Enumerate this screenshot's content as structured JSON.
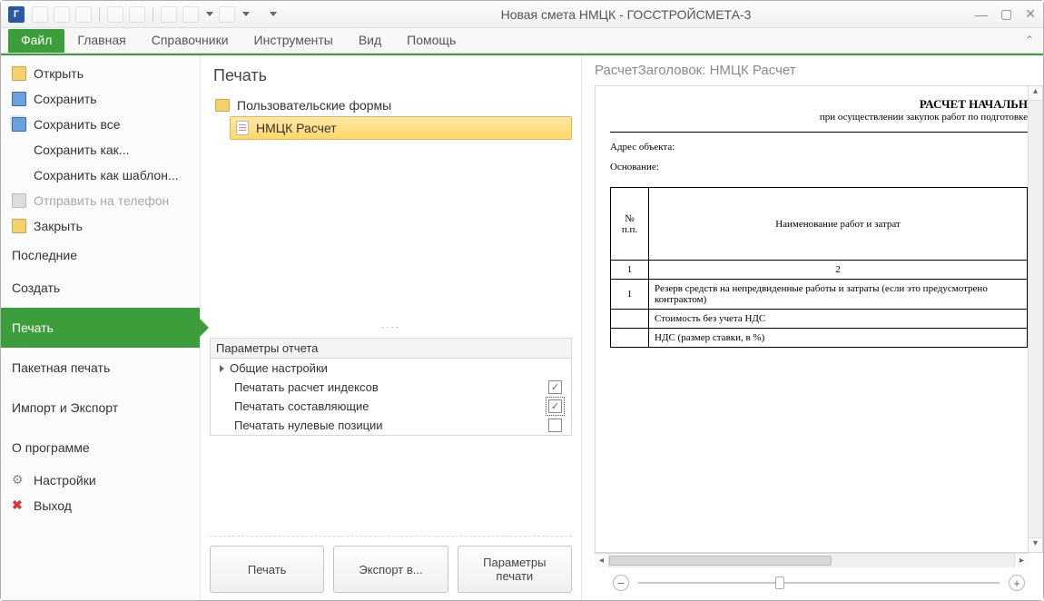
{
  "titlebar": {
    "title": "Новая смета НМЦК - ГОССТРОЙСМЕТА-3"
  },
  "ribbon": {
    "tabs": [
      "Файл",
      "Главная",
      "Справочники",
      "Инструменты",
      "Вид",
      "Помощь"
    ]
  },
  "file_menu": {
    "open": "Открыть",
    "save": "Сохранить",
    "save_all": "Сохранить все",
    "save_as": "Сохранить как...",
    "save_as_template": "Сохранить как шаблон...",
    "send_phone": "Отправить на телефон",
    "close": "Закрыть",
    "recent": "Последние",
    "create": "Создать",
    "print": "Печать",
    "batch_print": "Пакетная печать",
    "import_export": "Импорт и Экспорт",
    "about": "О программе",
    "settings": "Настройки",
    "exit": "Выход"
  },
  "center": {
    "heading": "Печать",
    "tree_root": "Пользовательские формы",
    "tree_item": "НМЦК Расчет",
    "params_header": "Параметры отчета",
    "params_group": "Общие настройки",
    "param1": "Печатать расчет индексов",
    "param2": "Печатать составляющие",
    "param3": "Печатать нулевые позиции",
    "param1_checked": true,
    "param2_checked": true,
    "param3_checked": false,
    "btn_print": "Печать",
    "btn_export": "Экспорт в...",
    "btn_page_setup": "Параметры печати"
  },
  "preview": {
    "title": "РасчетЗаголовок: НМЦК Расчет",
    "doc_heading": "РАСЧЕТ НАЧАЛЬН",
    "doc_sub": "при осуществлении закупок работ по подготовке",
    "addr_label": "Адрес объекта:",
    "basis_label": "Основание:",
    "col_num": "№ п.п.",
    "col_name": "Наименование работ и затрат",
    "colnum1": "1",
    "colnum2": "2",
    "row1_num": "1",
    "row1_text": "Резерв средств на непредвиденные работы и затраты (если это предусмотрено контрактом)",
    "row2_text": "Стоимость без учета НДС",
    "row3_text": "НДС (размер ставки, в %)"
  }
}
